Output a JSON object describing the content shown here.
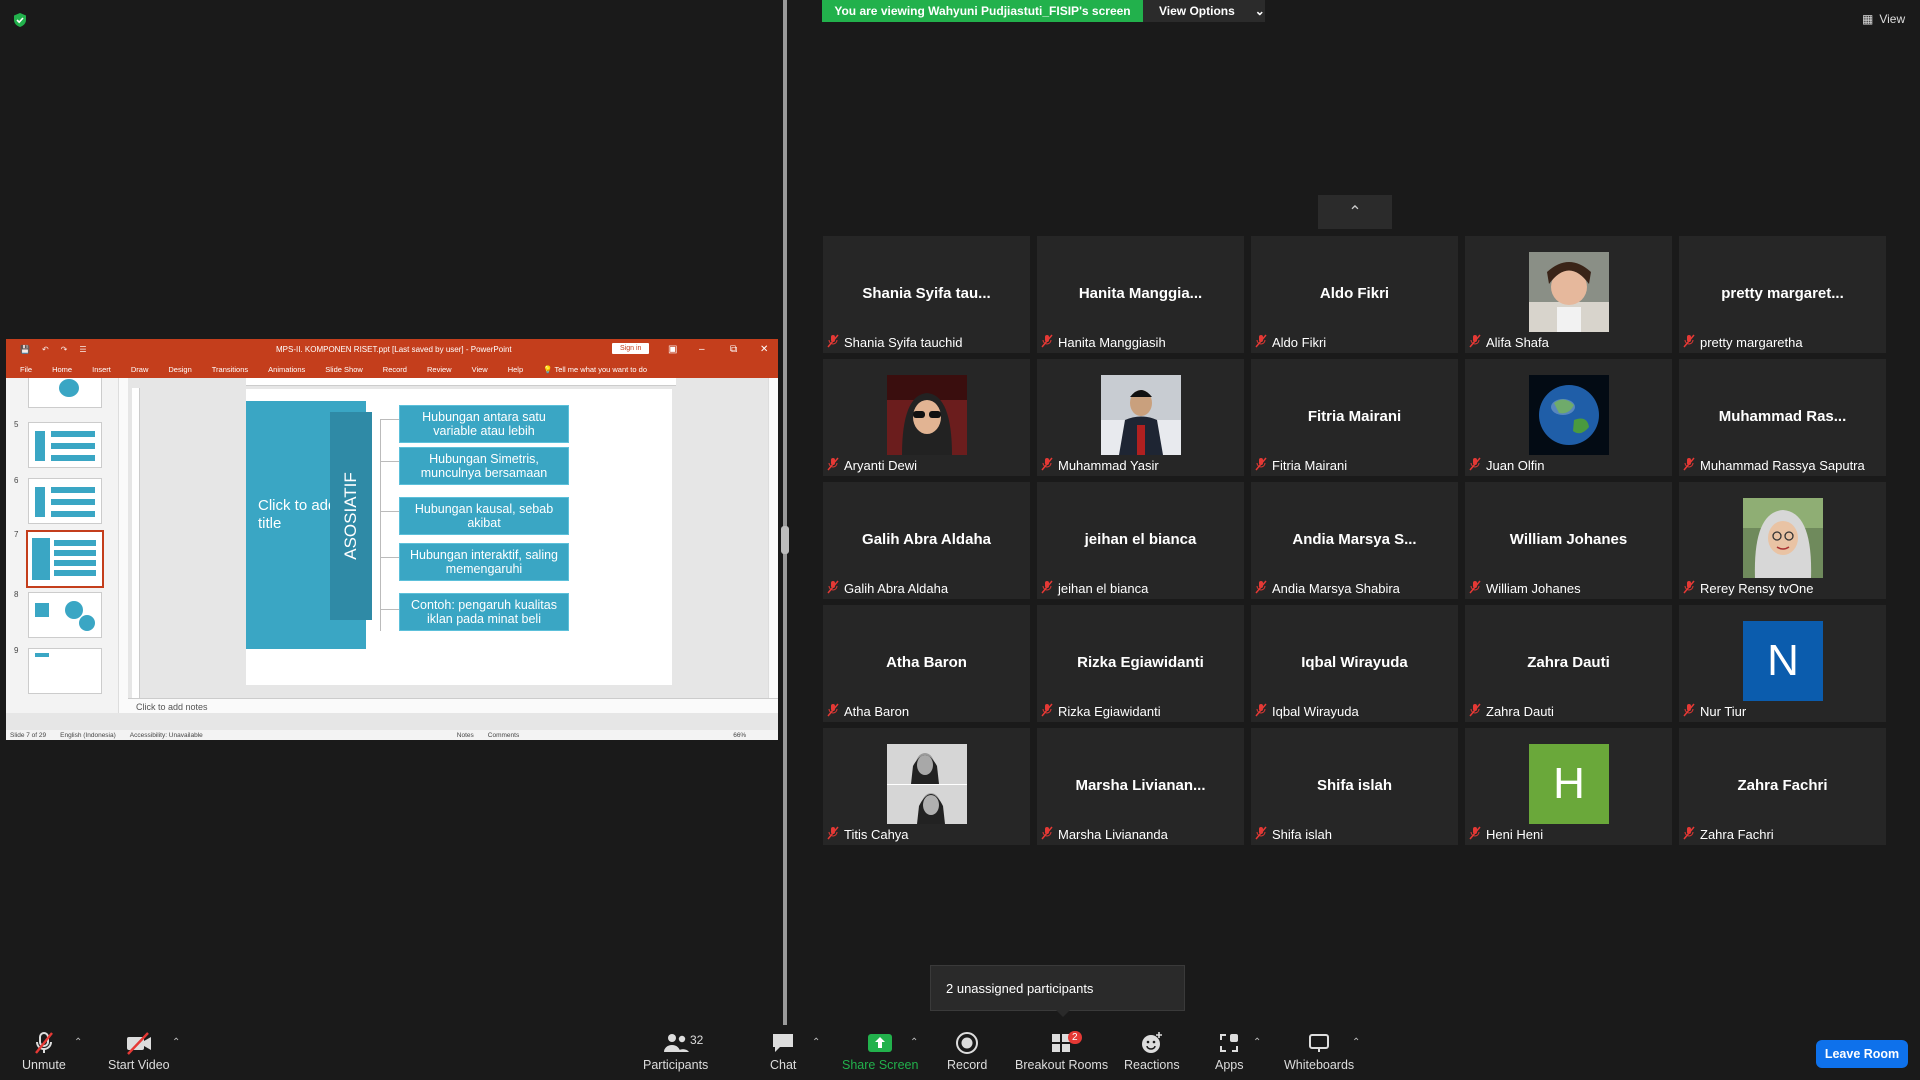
{
  "banner": {
    "viewing": "You are viewing Wahyuni Pudjiastuti_FISIP's screen",
    "view_options": "View Options",
    "view": "View"
  },
  "ppt": {
    "title": "MPS-II. KOMPONEN RISET.ppt [Last saved by user]  -  PowerPoint",
    "sign_in": "Sign in",
    "menu": [
      "File",
      "Home",
      "Insert",
      "Draw",
      "Design",
      "Transitions",
      "Animations",
      "Slide Show",
      "Record",
      "Review",
      "View",
      "Help",
      "Tell me what you want to do"
    ],
    "slide_numbers": [
      "5",
      "6",
      "7",
      "8",
      "9"
    ],
    "click_title": "Click to add title",
    "vertical_label": "ASOSIATIF",
    "items": [
      "Hubungan antara satu variable atau lebih",
      "Hubungan Simetris, munculnya bersamaan",
      "Hubungan kausal, sebab akibat",
      "Hubungan interaktif, saling memengaruhi",
      "Contoh: pengaruh kualitas iklan pada minat beli"
    ],
    "notes": "Click to add notes",
    "status": {
      "slide": "Slide 7 of 29",
      "lang": "English (Indonesia)",
      "access": "Accessibility: Unavailable",
      "notes_btn": "Notes",
      "comments_btn": "Comments",
      "zoom": "66%"
    }
  },
  "participants": [
    {
      "display": "Shania  Syifa  tau...",
      "label": "Shania Syifa tauchid"
    },
    {
      "display": "Hanita  Manggia...",
      "label": "Hanita Manggiasih"
    },
    {
      "display": "Aldo Fikri",
      "label": "Aldo Fikri"
    },
    {
      "display": "",
      "label": "Alifa Shafa",
      "photo": "woman-selfie"
    },
    {
      "display": "pretty  margaret...",
      "label": "pretty margaretha"
    },
    {
      "display": "",
      "label": "Aryanti Dewi",
      "photo": "woman-sunglasses"
    },
    {
      "display": "",
      "label": "Muhammad Yasir",
      "photo": "man-jacket"
    },
    {
      "display": "Fitria Mairani",
      "label": "Fitria Mairani"
    },
    {
      "display": "",
      "label": "Juan Olfin",
      "photo": "earth"
    },
    {
      "display": "Muhammad  Ras...",
      "label": "Muhammad Rassya Saputra"
    },
    {
      "display": "Galih Abra Aldaha",
      "label": "Galih Abra Aldaha"
    },
    {
      "display": "jeihan el bianca",
      "label": "jeihan el bianca"
    },
    {
      "display": "Andia  Marsya  S...",
      "label": "Andia Marsya Shabira"
    },
    {
      "display": "William Johanes",
      "label": "William Johanes"
    },
    {
      "display": "",
      "label": "Rerey Rensy tvOne",
      "photo": "woman-hijab"
    },
    {
      "display": "Atha Baron",
      "label": "Atha Baron"
    },
    {
      "display": "Rizka Egiawidanti",
      "label": "Rizka Egiawidanti"
    },
    {
      "display": "Iqbal Wirayuda",
      "label": "Iqbal Wirayuda"
    },
    {
      "display": "Zahra Dauti",
      "label": "Zahra Dauti"
    },
    {
      "display": "",
      "label": "Nur Tiur",
      "initial": "N",
      "color": "#0b5cad"
    },
    {
      "display": "",
      "label": "Titis Cahya",
      "photo": "bw-two-women"
    },
    {
      "display": "Marsha  Livianan...",
      "label": "Marsha Liviananda"
    },
    {
      "display": "Shifa islah",
      "label": "Shifa islah"
    },
    {
      "display": "",
      "label": "Heni Heni",
      "initial": "H",
      "color": "#6aa83a"
    },
    {
      "display": "Zahra Fachri",
      "label": "Zahra Fachri"
    }
  ],
  "unassigned": "2 unassigned participants",
  "toolbar": {
    "unmute": "Unmute",
    "start_video": "Start Video",
    "participants": "Participants",
    "participant_count": "32",
    "chat": "Chat",
    "share": "Share Screen",
    "record": "Record",
    "breakout": "Breakout Rooms",
    "breakout_badge": "2",
    "reactions": "Reactions",
    "apps": "Apps",
    "whiteboards": "Whiteboards",
    "leave": "Leave Room"
  },
  "colors": {
    "share_green": "#22b14c",
    "leave_blue": "#0e71eb",
    "ppt_red": "#c43e1c",
    "slide_teal": "#3aa6c4"
  }
}
